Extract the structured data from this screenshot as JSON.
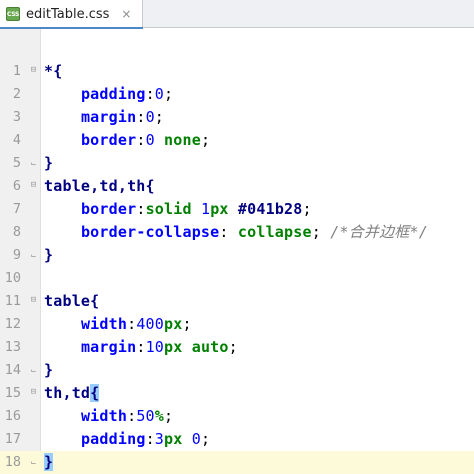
{
  "tab": {
    "icon": "css-file-icon",
    "icon_text": "CSS",
    "filename": "editTable.css",
    "close_glyph": "×"
  },
  "editor": {
    "current_line": 18,
    "lines": [
      {
        "n": "1",
        "tokens": [
          [
            "t-sel",
            "*{"
          ]
        ],
        "fold": "open"
      },
      {
        "n": "2",
        "tokens": [
          [
            "t-pun",
            "    "
          ],
          [
            "t-prop",
            "padding"
          ],
          [
            "t-pun",
            ":"
          ],
          [
            "t-num",
            "0"
          ],
          [
            "t-pun",
            ";"
          ]
        ]
      },
      {
        "n": "3",
        "tokens": [
          [
            "t-pun",
            "    "
          ],
          [
            "t-prop",
            "margin"
          ],
          [
            "t-pun",
            ":"
          ],
          [
            "t-num",
            "0"
          ],
          [
            "t-pun",
            ";"
          ]
        ]
      },
      {
        "n": "4",
        "tokens": [
          [
            "t-pun",
            "    "
          ],
          [
            "t-prop",
            "border"
          ],
          [
            "t-pun",
            ":"
          ],
          [
            "t-num",
            "0 "
          ],
          [
            "t-kw",
            "none"
          ],
          [
            "t-pun",
            ";"
          ]
        ]
      },
      {
        "n": "5",
        "tokens": [
          [
            "t-sel",
            "}"
          ]
        ],
        "fold": "close"
      },
      {
        "n": "6",
        "tokens": [
          [
            "t-sel",
            "table,td,th{"
          ]
        ],
        "fold": "open"
      },
      {
        "n": "7",
        "tokens": [
          [
            "t-pun",
            "    "
          ],
          [
            "t-prop",
            "border"
          ],
          [
            "t-pun",
            ":"
          ],
          [
            "t-kw",
            "solid "
          ],
          [
            "t-num",
            "1"
          ],
          [
            "t-kw",
            "px "
          ],
          [
            "t-col",
            "#041b28"
          ],
          [
            "t-pun",
            ";"
          ]
        ]
      },
      {
        "n": "8",
        "tokens": [
          [
            "t-pun",
            "    "
          ],
          [
            "t-prop",
            "border-collapse"
          ],
          [
            "t-pun",
            ": "
          ],
          [
            "t-kw",
            "collapse"
          ],
          [
            "t-pun",
            "; "
          ],
          [
            "t-cmt",
            "/*合并边框*/"
          ]
        ]
      },
      {
        "n": "9",
        "tokens": [
          [
            "t-sel",
            "}"
          ]
        ],
        "fold": "close"
      },
      {
        "n": "10",
        "tokens": []
      },
      {
        "n": "11",
        "tokens": [
          [
            "t-sel",
            "table{"
          ]
        ],
        "fold": "open"
      },
      {
        "n": "12",
        "tokens": [
          [
            "t-pun",
            "    "
          ],
          [
            "t-prop",
            "width"
          ],
          [
            "t-pun",
            ":"
          ],
          [
            "t-num",
            "400"
          ],
          [
            "t-kw",
            "px"
          ],
          [
            "t-pun",
            ";"
          ]
        ]
      },
      {
        "n": "13",
        "tokens": [
          [
            "t-pun",
            "    "
          ],
          [
            "t-prop",
            "margin"
          ],
          [
            "t-pun",
            ":"
          ],
          [
            "t-num",
            "10"
          ],
          [
            "t-kw",
            "px auto"
          ],
          [
            "t-pun",
            ";"
          ]
        ]
      },
      {
        "n": "14",
        "tokens": [
          [
            "t-sel",
            "}"
          ]
        ],
        "fold": "close"
      },
      {
        "n": "15",
        "tokens": [
          [
            "t-sel",
            "th,td"
          ],
          [
            "t-sel t-br-hl",
            "{"
          ]
        ],
        "fold": "open"
      },
      {
        "n": "16",
        "tokens": [
          [
            "t-pun",
            "    "
          ],
          [
            "t-prop",
            "width"
          ],
          [
            "t-pun",
            ":"
          ],
          [
            "t-num",
            "50"
          ],
          [
            "t-kw",
            "%"
          ],
          [
            "t-pun",
            ";"
          ]
        ]
      },
      {
        "n": "17",
        "tokens": [
          [
            "t-pun",
            "    "
          ],
          [
            "t-prop",
            "padding"
          ],
          [
            "t-pun",
            ":"
          ],
          [
            "t-num",
            "3"
          ],
          [
            "t-kw",
            "px "
          ],
          [
            "t-num",
            "0"
          ],
          [
            "t-pun",
            ";"
          ]
        ]
      },
      {
        "n": "18",
        "tokens": [
          [
            "t-sel t-br-hl",
            "}"
          ]
        ],
        "fold": "close"
      }
    ]
  }
}
